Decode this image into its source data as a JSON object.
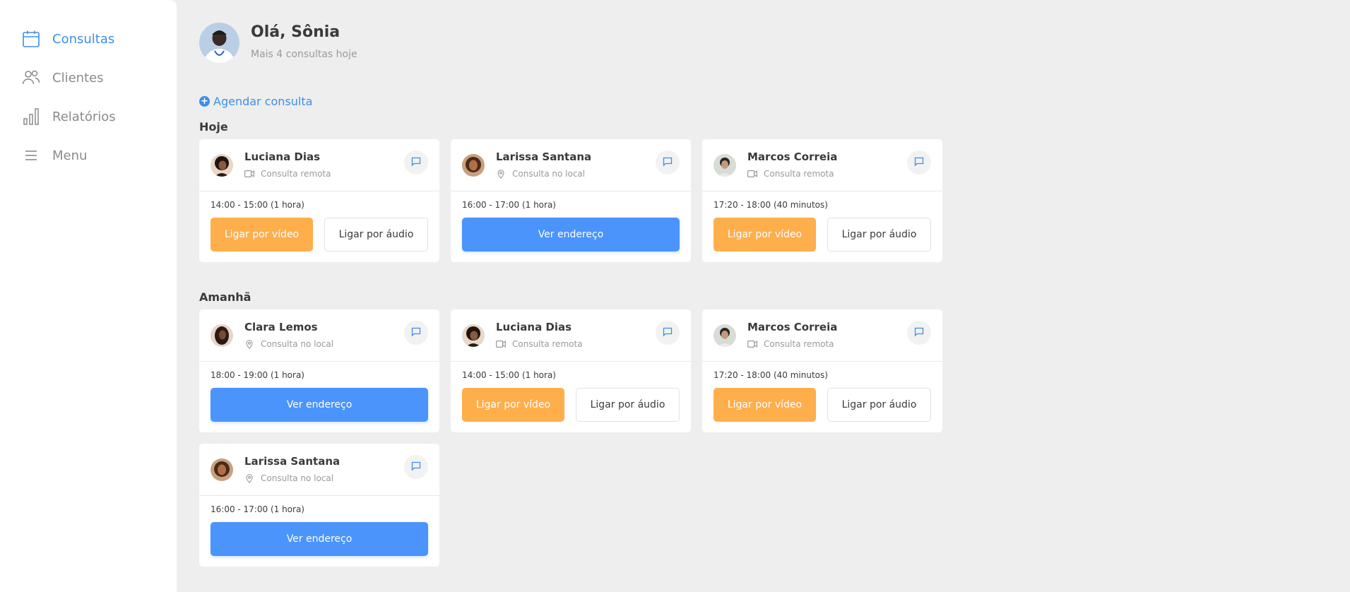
{
  "sidebar": {
    "items": [
      {
        "label": "Consultas",
        "icon": "calendar-icon",
        "active": true
      },
      {
        "label": "Clientes",
        "icon": "users-icon",
        "active": false
      },
      {
        "label": "Relatórios",
        "icon": "bar-chart-icon",
        "active": false
      },
      {
        "label": "Menu",
        "icon": "menu-icon",
        "active": false
      }
    ]
  },
  "header": {
    "greeting": "Olá, Sônia",
    "subtitle": "Mais 4 consultas hoje"
  },
  "schedule_link": {
    "plus": "+",
    "label": "Agendar consulta"
  },
  "sections": [
    {
      "title": "Hoje",
      "cards": [
        {
          "name": "Luciana Dias",
          "type": "Consulta remota",
          "type_icon": "video-icon",
          "time": "14:00 - 15:00 (1 hora)",
          "video_label": "Ligar por vídeo",
          "audio_label": "Ligar por áudio"
        },
        {
          "name": "Larissa Santana",
          "type": "Consulta no local",
          "type_icon": "location-pin-icon",
          "time": "16:00 - 17:00 (1 hora)",
          "address_label": "Ver endereço"
        },
        {
          "name": "Marcos Correia",
          "type": "Consulta remota",
          "type_icon": "video-icon",
          "time": "17:20 - 18:00 (40 minutos)",
          "video_label": "Ligar por vídeo",
          "audio_label": "Ligar por áudio"
        }
      ]
    },
    {
      "title": "Amanhã",
      "cards": [
        {
          "name": "Clara Lemos",
          "type": "Consulta no local",
          "type_icon": "location-pin-icon",
          "time": "18:00 - 19:00 (1 hora)",
          "address_label": "Ver endereço"
        },
        {
          "name": "Luciana Dias",
          "type": "Consulta remota",
          "type_icon": "video-icon",
          "time": "14:00 - 15:00 (1 hora)",
          "video_label": "Ligar por vídeo",
          "audio_label": "Ligar por áudio"
        },
        {
          "name": "Marcos Correia",
          "type": "Consulta remota",
          "type_icon": "video-icon",
          "time": "17:20 - 18:00 (40 minutos)",
          "video_label": "Ligar por vídeo",
          "audio_label": "Ligar por áudio"
        },
        {
          "name": "Larissa Santana",
          "type": "Consulta no local",
          "type_icon": "location-pin-icon",
          "time": "16:00 - 17:00 (1 hora)",
          "address_label": "Ver endereço"
        }
      ]
    }
  ],
  "colors": {
    "accent": "#3d8fe8",
    "video_button": "#ffae4c",
    "address_button": "#4b94fb",
    "background": "#eeeeee"
  }
}
